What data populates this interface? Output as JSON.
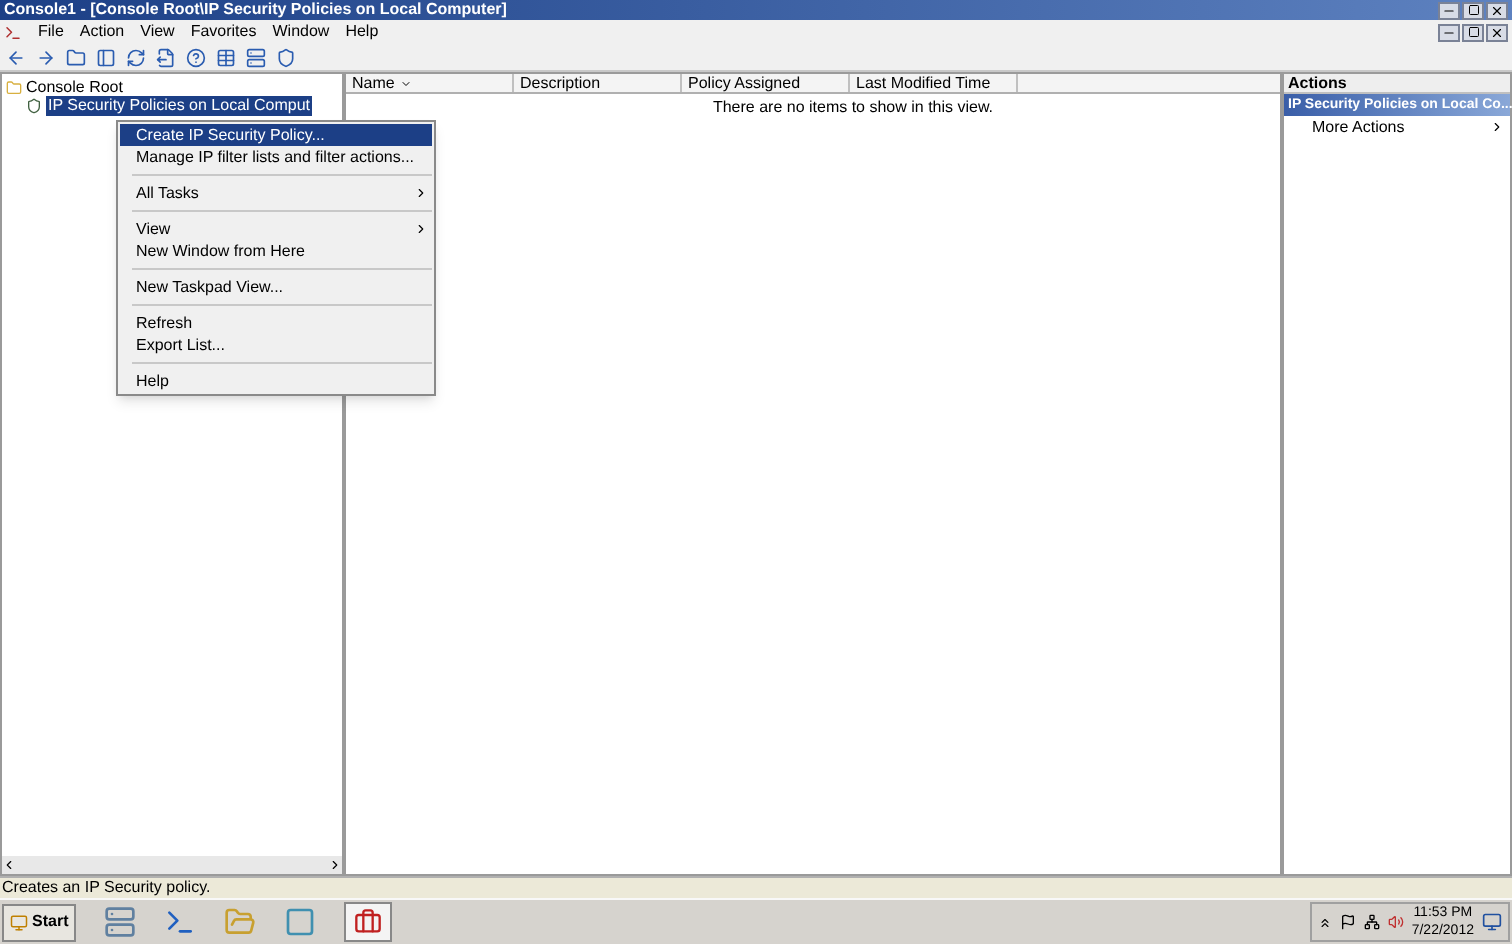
{
  "window": {
    "title": "Console1 - [Console Root\\IP Security Policies on Local Computer]"
  },
  "menu_bar": [
    "File",
    "Action",
    "View",
    "Favorites",
    "Window",
    "Help"
  ],
  "tree": {
    "root": "Console Root",
    "children": [
      {
        "label": "IP Security Policies on Local Comput",
        "selected": true
      }
    ]
  },
  "context_menu": [
    {
      "kind": "item",
      "label": "Create IP Security Policy...",
      "selected": true,
      "submenu": false
    },
    {
      "kind": "item",
      "label": "Manage IP filter lists and filter actions...",
      "selected": false,
      "submenu": false
    },
    {
      "kind": "separator"
    },
    {
      "kind": "item",
      "label": "All Tasks",
      "selected": false,
      "submenu": true
    },
    {
      "kind": "separator"
    },
    {
      "kind": "item",
      "label": "View",
      "selected": false,
      "submenu": true
    },
    {
      "kind": "item",
      "label": "New Window from Here",
      "selected": false,
      "submenu": false
    },
    {
      "kind": "separator"
    },
    {
      "kind": "item",
      "label": "New Taskpad View...",
      "selected": false,
      "submenu": false
    },
    {
      "kind": "separator"
    },
    {
      "kind": "item",
      "label": "Refresh",
      "selected": false,
      "submenu": false
    },
    {
      "kind": "item",
      "label": "Export List...",
      "selected": false,
      "submenu": false
    },
    {
      "kind": "separator"
    },
    {
      "kind": "item",
      "label": "Help",
      "selected": false,
      "submenu": false
    }
  ],
  "list": {
    "columns": [
      {
        "label": "Name",
        "sorted": true
      },
      {
        "label": "Description",
        "sorted": false
      },
      {
        "label": "Policy Assigned",
        "sorted": false
      },
      {
        "label": "Last Modified Time",
        "sorted": false
      }
    ],
    "empty_message": "There are no items to show in this view."
  },
  "actions": {
    "title": "Actions",
    "section": "IP Security Policies on Local Co...",
    "items": [
      "More Actions"
    ]
  },
  "status_bar": "Creates an IP Security policy.",
  "taskbar": {
    "start": "Start",
    "time": "11:53 PM",
    "date": "7/22/2012"
  }
}
